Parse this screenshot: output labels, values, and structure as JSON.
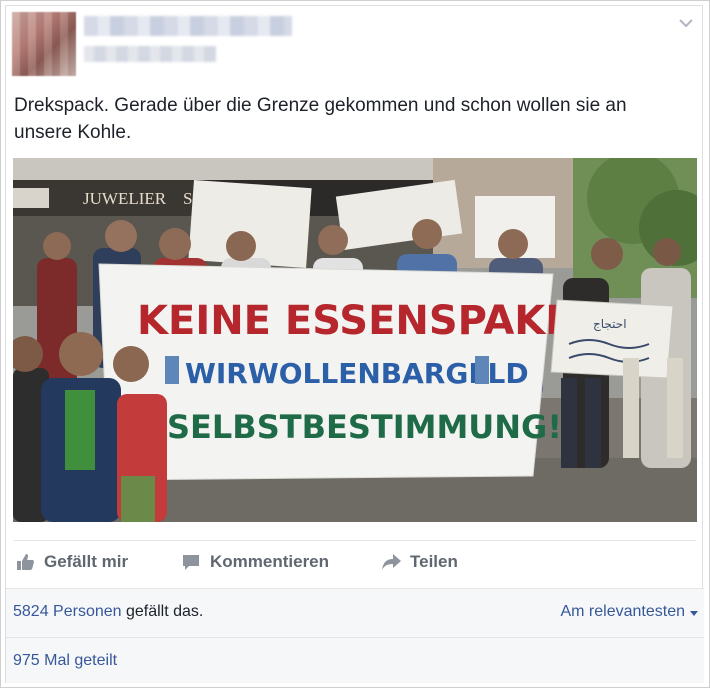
{
  "post": {
    "text": "Drekspack. Gerade über die Grenze gekommen und schon wollen sie an unsere Kohle.",
    "menu_icon": "chevron-down-icon"
  },
  "photo": {
    "shop_sign": "JUWELIER",
    "shop_sign_partial": "S",
    "banner_line1": "KEINE ESSENSPAKETE",
    "banner_line2": "WIRWOLLENBARGELD",
    "banner_line3": "SELBSTBESTIMMUNG!",
    "side_sign": "احتجاج"
  },
  "actions": {
    "like_label": "Gefällt mir",
    "comment_label": "Kommentieren",
    "share_label": "Teilen"
  },
  "stats": {
    "likes_link": "5824 Personen",
    "likes_suffix": " gefällt das.",
    "sort_label": "Am relevantesten",
    "shares": "975 Mal geteilt"
  },
  "colors": {
    "link": "#365899",
    "action_gray": "#606770",
    "banner_red": "#b5262d",
    "banner_blue": "#2b5fa8",
    "banner_green": "#1f6b48"
  }
}
